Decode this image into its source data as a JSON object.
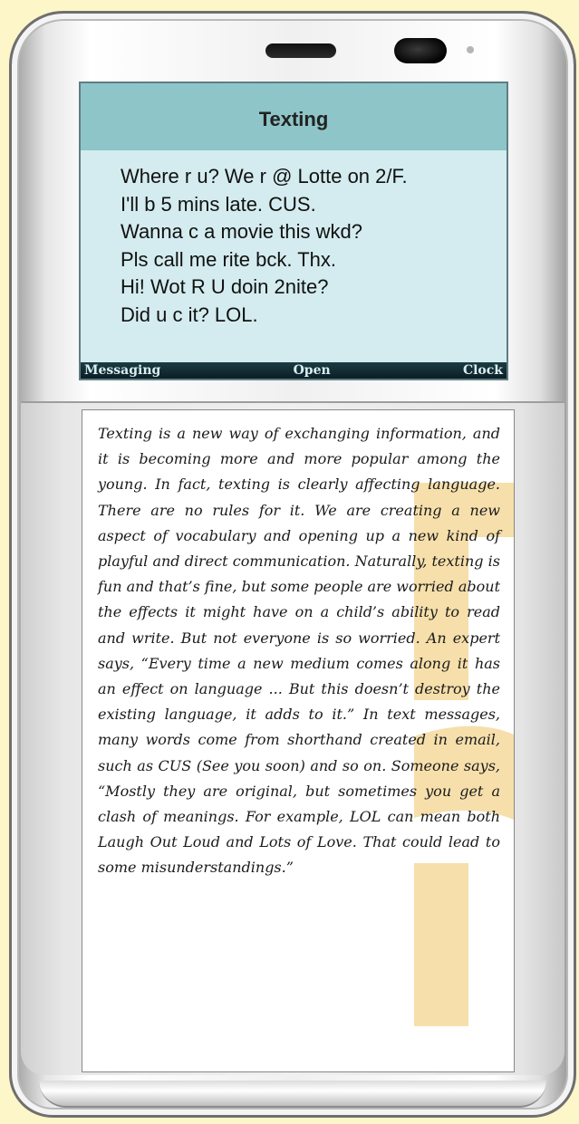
{
  "screen": {
    "title": "Texting",
    "messages": [
      "Where r u? We r @ Lotte on 2/F.",
      "I'll b 5 mins late. CUS.",
      "Wanna c a movie this wkd?",
      "Pls call me rite bck. Thx.",
      "Hi! Wot R U doin 2nite?",
      "Did u c it? LOL."
    ],
    "softkeys": {
      "left": "Messaging",
      "center": "Open",
      "right": "Clock"
    }
  },
  "article": {
    "text": "Texting is a new way of exchanging information, and it is becoming more and more popular among the young. In fact, texting is clearly affecting language. There are no rules for it. We are creating a new aspect of vocabulary and opening up a new kind of playful and direct communication. Naturally, texting is fun and that’s fine, but some people are worried about the effects it might have on a child’s ability to read and write. But not everyone is so worried. An expert says, “Every time a new medium comes along it has an effect on language ... But this doesn’t destroy the existing language, it adds to it.” In text messages, many words come from shorthand created in email, such as CUS (See you soon) and so on. Someone says, “Mostly they are original, but sometimes you get a clash of meanings. For example, LOL can mean both Laugh Out Loud and Lots of Love. That could lead to some misunderstandings.”"
  },
  "colors": {
    "page_background": "#fdf6c9",
    "screen_header": "#8ec5c8",
    "screen_body": "#d4ecef",
    "softkey_bar": "#0b1e24",
    "watermark": "#f3d48f"
  }
}
